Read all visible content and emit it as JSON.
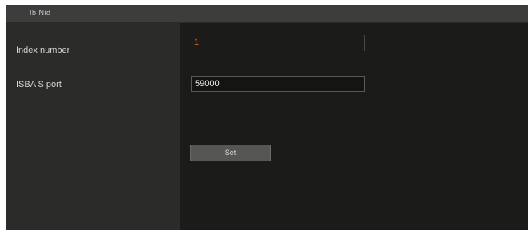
{
  "window": {
    "title": "Ib Nid"
  },
  "rows": [
    {
      "label": "Index number",
      "value": "1"
    },
    {
      "label": "ISBA S port",
      "value": "59000"
    }
  ],
  "actions": {
    "set_label": "Set"
  },
  "colors": {
    "readonly_value": "#c8602a",
    "panel_background": "#1b1c1a",
    "label_column": "#2b2c2a"
  }
}
